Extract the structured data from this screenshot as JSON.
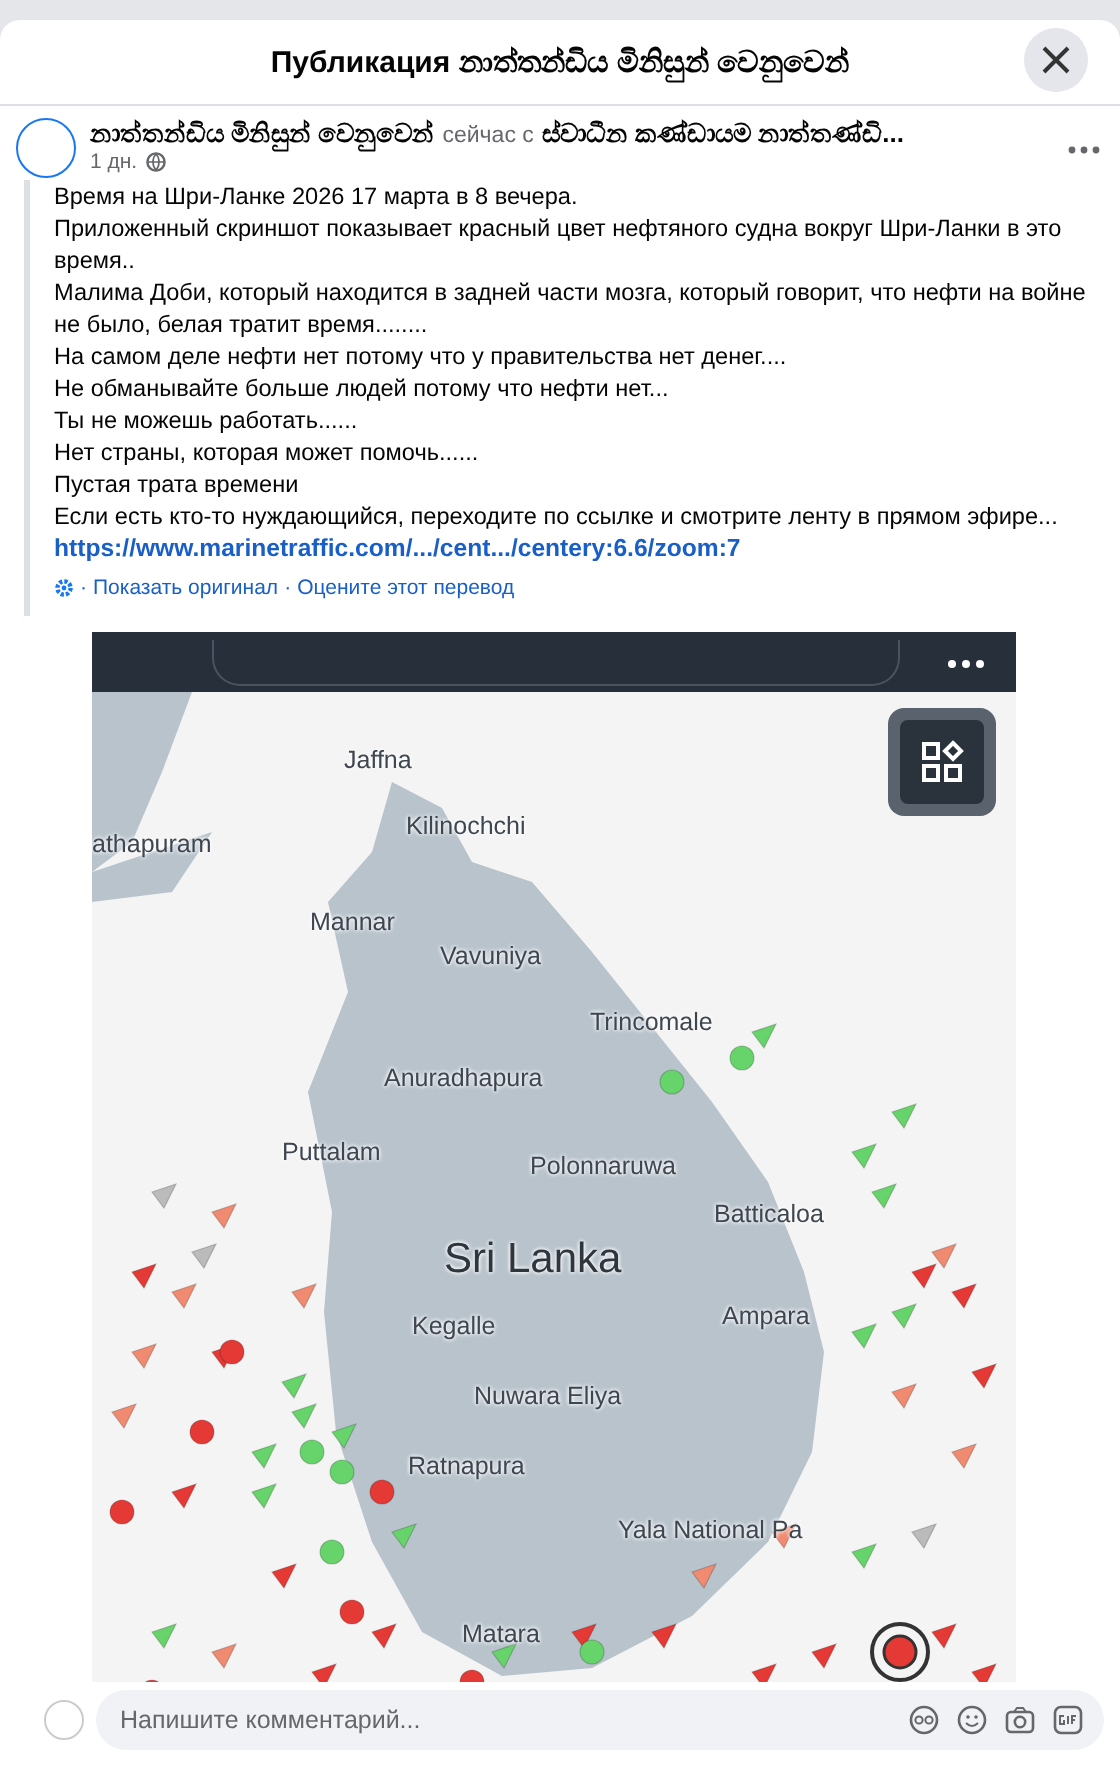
{
  "dialog": {
    "title": "Публикация නාත්තන්ඩිය මිනිසුන් වෙනුවෙන්"
  },
  "post": {
    "author": "නාත්තන්ඩිය මිනිසුන් වෙනුවෙන්",
    "shared_label": "сейчас с",
    "group": "ස්වාධීන කණ්ඩායම නාත්තණ්ඩි...",
    "time": "1 дн.",
    "body_lines": [
      "Время на Шри-Ланке 2026 17 марта в 8 вечера.",
      "Приложенный скриншот показывает красный цвет нефтяного судна вокруг Шри-Ланки в это время..",
      "Малима Доби, который находится в задней части мозга, который говорит, что нефти на войне не было, белая тратит время........",
      "На самом деле нефти нет потому что у правительства нет денег....",
      "Не обманывайте больше людей потому что нефти нет...",
      "Ты не можешь работать......",
      "Нет страны, которая может помочь......",
      "Пустая трата времени",
      "Если есть кто-то нуждающийся, переходите по ссылке и смотрите ленту в прямом эфире..."
    ],
    "link": "https://www.marinetraffic.com/.../cent.../centery:6.6/zoom:7",
    "translation_links": [
      "Показать оригинал",
      "Оцените этот перевод"
    ],
    "separator": "·"
  },
  "map": {
    "labels": [
      {
        "text": "Jaffna",
        "kind": "city"
      },
      {
        "text": "Kilinochchi",
        "kind": "city"
      },
      {
        "text": "athapuram",
        "kind": "city"
      },
      {
        "text": "Mannar",
        "kind": "city"
      },
      {
        "text": "Vavuniya",
        "kind": "city"
      },
      {
        "text": "Trincomale",
        "kind": "city"
      },
      {
        "text": "Anuradhapura",
        "kind": "city"
      },
      {
        "text": "Puttalam",
        "kind": "city"
      },
      {
        "text": "Polonnaruwa",
        "kind": "city"
      },
      {
        "text": "Batticaloa",
        "kind": "city"
      },
      {
        "text": "Sri Lanka",
        "kind": "country"
      },
      {
        "text": "Kegalle",
        "kind": "city"
      },
      {
        "text": "Ampara",
        "kind": "city"
      },
      {
        "text": "Nuwara Eliya",
        "kind": "city"
      },
      {
        "text": "Ratnapura",
        "kind": "city"
      },
      {
        "text": "Yala National Pa",
        "kind": "city"
      },
      {
        "text": "Matara",
        "kind": "city"
      }
    ]
  },
  "comment": {
    "placeholder": "Напишите комментарий..."
  }
}
